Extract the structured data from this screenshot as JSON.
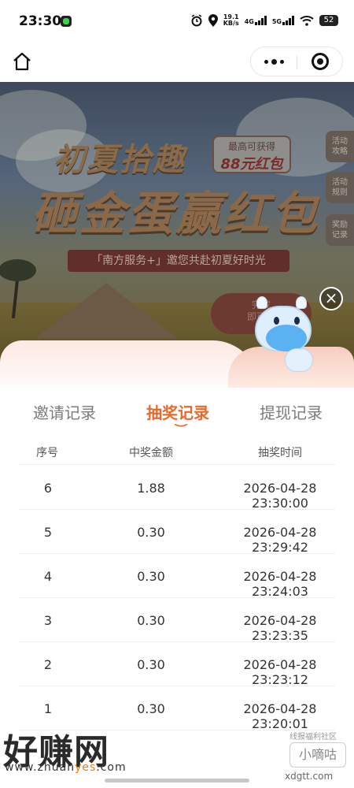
{
  "status_bar": {
    "time": "23:30",
    "net_speed_value": "19.1",
    "net_speed_unit": "KB/s",
    "signal1_label": "4G",
    "signal2_label": "5G",
    "battery": "52"
  },
  "banner": {
    "title_line1": "初夏拾趣",
    "title_line2": "砸金蛋赢红包",
    "max_label": "最高可获得",
    "max_amount": "88元红包",
    "subtitle": "「南方服务+」邀您共赴初夏好时光",
    "side_tabs": [
      {
        "line1": "活动",
        "line2": "攻略"
      },
      {
        "line1": "活动",
        "line2": "规则"
      },
      {
        "line1": "奖励",
        "line2": "记录"
      }
    ],
    "complete_line1": "完成",
    "complete_line2": "即可获"
  },
  "close_label": "×",
  "tabs": [
    {
      "label": "邀请记录",
      "active": false
    },
    {
      "label": "抽奖记录",
      "active": true
    },
    {
      "label": "提现记录",
      "active": false
    }
  ],
  "table": {
    "headers": [
      "序号",
      "中奖金额",
      "抽奖时间"
    ],
    "rows": [
      {
        "index": "6",
        "amount": "1.88",
        "time": "2026-04-28 23:30:00"
      },
      {
        "index": "5",
        "amount": "0.30",
        "time": "2026-04-28 23:29:42"
      },
      {
        "index": "4",
        "amount": "0.30",
        "time": "2026-04-28 23:24:03"
      },
      {
        "index": "3",
        "amount": "0.30",
        "time": "2026-04-28 23:23:35"
      },
      {
        "index": "2",
        "amount": "0.30",
        "time": "2026-04-28 23:23:12"
      },
      {
        "index": "1",
        "amount": "0.30",
        "time": "2026-04-28 23:20:01"
      }
    ]
  },
  "watermarks": {
    "left_logo": "好赚网",
    "left_url_prefix": "www.zhuan",
    "left_url_highlight": "yes",
    "left_url_suffix": ".com",
    "right_small": "线报福利社区",
    "right_big": "小嘀咕",
    "right_url": "xdgtt.com"
  },
  "colors": {
    "accent": "#e86a2a",
    "sheet_gradient": "#fde8e3"
  }
}
